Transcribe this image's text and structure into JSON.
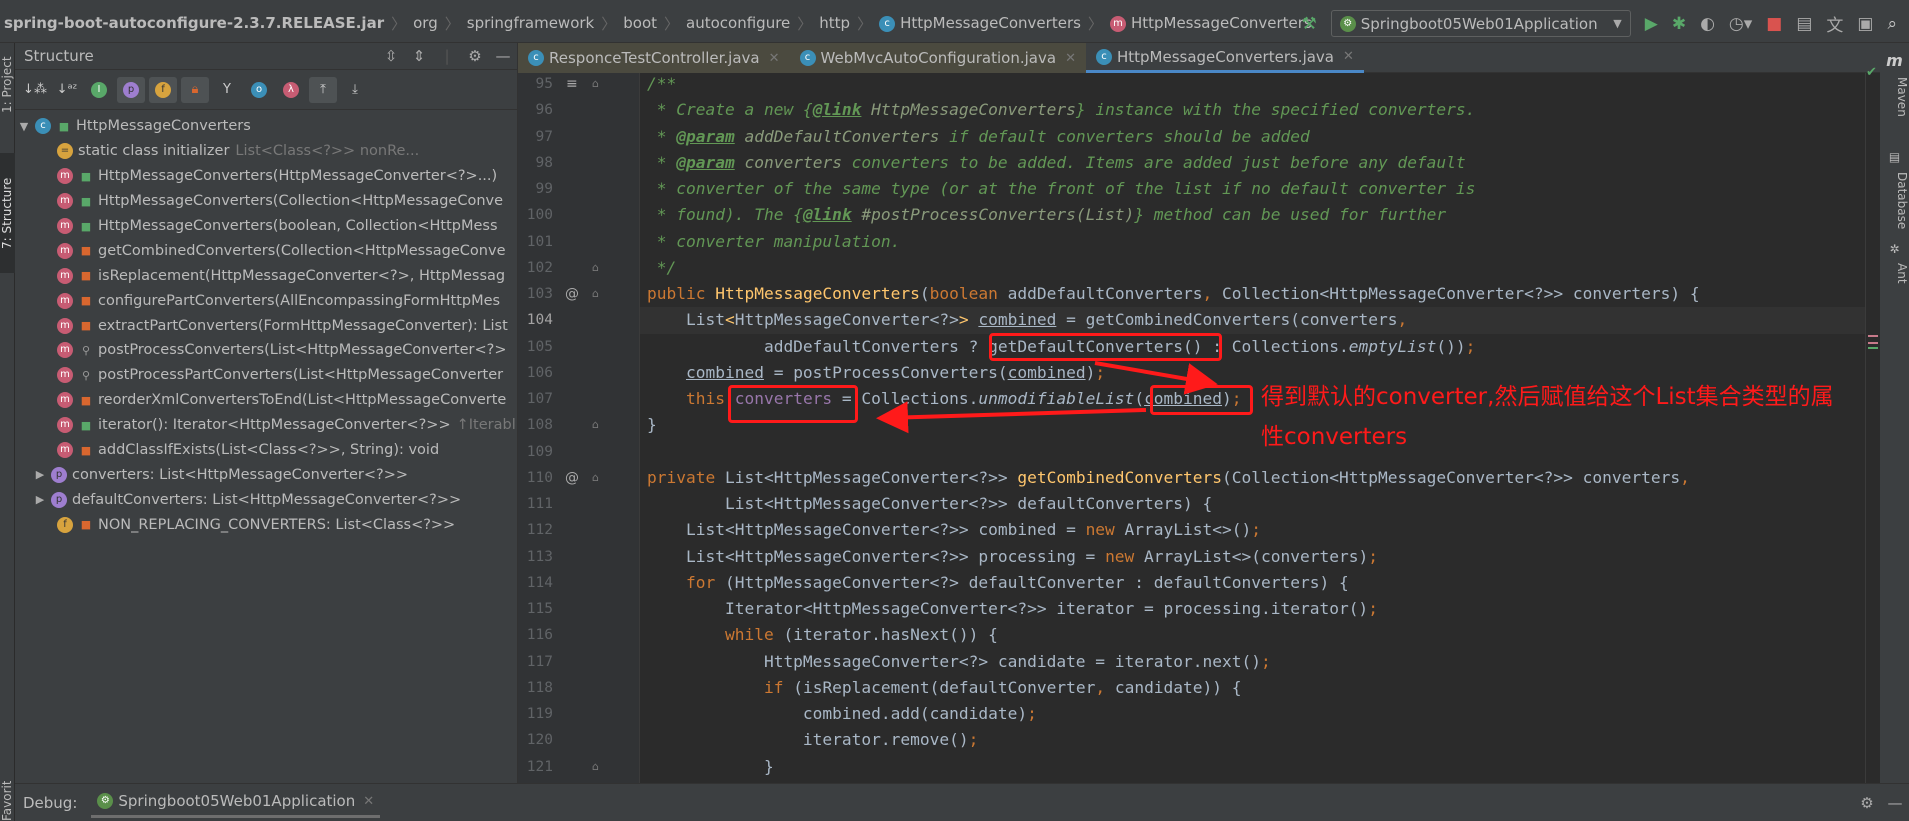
{
  "breadcrumb": [
    {
      "label": "spring-boot-autoconfigure-2.3.7.RELEASE.jar",
      "bold": true
    },
    {
      "label": "org"
    },
    {
      "label": "springframework"
    },
    {
      "label": "boot"
    },
    {
      "label": "autoconfigure"
    },
    {
      "label": "http"
    },
    {
      "label": "HttpMessageConverters",
      "icon": "c"
    },
    {
      "label": "HttpMessageConverters",
      "icon": "m"
    }
  ],
  "run_config": "Springboot05Web01Application",
  "left_strip": {
    "project": "1: Project",
    "structure": "7: Structure",
    "favorites": "Favorites"
  },
  "structure": {
    "title": "Structure",
    "tree": [
      {
        "level": 0,
        "expander": "down",
        "icon": "c",
        "access": "pub",
        "label": "HttpMessageConverters"
      },
      {
        "level": 1,
        "icon": "s",
        "access": "",
        "label": "static class initializer",
        "extra": "List<Class<?>> nonRe..."
      },
      {
        "level": 1,
        "icon": "m",
        "access": "pub",
        "label": "HttpMessageConverters(HttpMessageConverter<?>...)"
      },
      {
        "level": 1,
        "icon": "m",
        "access": "pub",
        "label": "HttpMessageConverters(Collection<HttpMessageConve"
      },
      {
        "level": 1,
        "icon": "m",
        "access": "pub",
        "label": "HttpMessageConverters(boolean, Collection<HttpMess"
      },
      {
        "level": 1,
        "icon": "m",
        "access": "pri",
        "label": "getCombinedConverters(Collection<HttpMessageConve"
      },
      {
        "level": 1,
        "icon": "m",
        "access": "pri",
        "label": "isReplacement(HttpMessageConverter<?>, HttpMessag"
      },
      {
        "level": 1,
        "icon": "m",
        "access": "pri",
        "label": "configurePartConverters(AllEncompassingFormHttpMes"
      },
      {
        "level": 1,
        "icon": "m",
        "access": "pri",
        "label": "extractPartConverters(FormHttpMessageConverter): List"
      },
      {
        "level": 1,
        "icon": "m",
        "access": "pkg",
        "label": "postProcessConverters(List<HttpMessageConverter<?>"
      },
      {
        "level": 1,
        "icon": "m",
        "access": "pkg",
        "label": "postProcessPartConverters(List<HttpMessageConverter"
      },
      {
        "level": 1,
        "icon": "m",
        "access": "pri",
        "label": "reorderXmlConvertersToEnd(List<HttpMessageConverte"
      },
      {
        "level": 1,
        "icon": "m",
        "access": "pub",
        "label": "iterator(): Iterator<HttpMessageConverter<?>>",
        "extra": "↑Iterabl"
      },
      {
        "level": 1,
        "icon": "m",
        "access": "pri",
        "label": "addClassIfExists(List<Class<?>>, String): void"
      },
      {
        "level": 1,
        "expander": "right",
        "icon": "p",
        "access": "",
        "label": "converters: List<HttpMessageConverter<?>>"
      },
      {
        "level": 1,
        "expander": "right",
        "icon": "p",
        "access": "",
        "label": "defaultConverters: List<HttpMessageConverter<?>>"
      },
      {
        "level": 1,
        "icon": "f",
        "access": "pri",
        "label": "NON_REPLACING_CONVERTERS: List<Class<?>>"
      }
    ]
  },
  "tabs": [
    {
      "label": "ResponceTestController.java",
      "active": false
    },
    {
      "label": "WebMvcAutoConfiguration.java",
      "active": false
    },
    {
      "label": "HttpMessageConverters.java",
      "active": true
    }
  ],
  "editor": {
    "current_line": 104,
    "lines": [
      {
        "n": 95,
        "mark": "fold",
        "t": [
          [
            "c",
            "/**"
          ]
        ]
      },
      {
        "n": 96,
        "t": [
          [
            "c",
            " * Create a new {"
          ],
          [
            "ct",
            "@link"
          ],
          [
            "cl",
            " HttpMessageConverters"
          ],
          [
            "c",
            "} instance with the specified converters."
          ]
        ]
      },
      {
        "n": 97,
        "t": [
          [
            "c",
            " * "
          ],
          [
            "ct",
            "@param"
          ],
          [
            "cl",
            " addDefaultConverters"
          ],
          [
            "c",
            " if default converters should be added"
          ]
        ]
      },
      {
        "n": 98,
        "t": [
          [
            "c",
            " * "
          ],
          [
            "ct",
            "@param"
          ],
          [
            "cl",
            " converters"
          ],
          [
            "c",
            " converters to be added. Items are added just before any default"
          ]
        ]
      },
      {
        "n": 99,
        "t": [
          [
            "c",
            " * converter of the same type (or at the front of the list if no default converter is"
          ]
        ]
      },
      {
        "n": 100,
        "t": [
          [
            "c",
            " * found). The {"
          ],
          [
            "ct",
            "@link"
          ],
          [
            "cl",
            " #postProcessConverters(List)"
          ],
          [
            "c",
            "} method can be used for further"
          ]
        ]
      },
      {
        "n": 101,
        "t": [
          [
            "c",
            " * converter manipulation."
          ]
        ]
      },
      {
        "n": 102,
        "mark": "foldend",
        "t": [
          [
            "c",
            " */"
          ]
        ]
      },
      {
        "n": 103,
        "mark": "at",
        "t": [
          [
            "k",
            "public "
          ],
          [
            "m",
            "HttpMessageConverters"
          ],
          [
            "p",
            "("
          ],
          [
            "k",
            "boolean "
          ],
          [
            "p",
            "addDefaultConverters"
          ],
          [
            "pn",
            ", "
          ],
          [
            "p",
            "Collection<HttpMessageConverter<?>> converters) {"
          ]
        ]
      },
      {
        "n": 104,
        "t": [
          [
            "p",
            "    List"
          ],
          [
            "m",
            "<"
          ],
          [
            "p",
            "HttpMessageConverter<?>"
          ],
          [
            "m",
            ">"
          ],
          [
            "p",
            " "
          ],
          [
            "u",
            "combined"
          ],
          [
            "p",
            " = getCombinedConverters(converters"
          ],
          [
            "pn",
            ","
          ]
        ]
      },
      {
        "n": 105,
        "t": [
          [
            "p",
            "            addDefaultConverters ? getDefaultConverters() : Collections."
          ],
          [
            "i",
            "emptyList"
          ],
          [
            "p",
            "())"
          ],
          [
            "pn",
            ";"
          ]
        ]
      },
      {
        "n": 106,
        "t": [
          [
            "p",
            "    "
          ],
          [
            "u",
            "combined"
          ],
          [
            "p",
            " = postProcessConverters("
          ],
          [
            "u",
            "combined"
          ],
          [
            "p",
            ")"
          ],
          [
            "pn",
            ";"
          ]
        ]
      },
      {
        "n": 107,
        "t": [
          [
            "p",
            "    "
          ],
          [
            "k",
            "this"
          ],
          [
            "p",
            "."
          ],
          [
            "f",
            "converters"
          ],
          [
            "p",
            " = Collections."
          ],
          [
            "i",
            "unmodifiableList"
          ],
          [
            "p",
            "("
          ],
          [
            "u",
            "combined"
          ],
          [
            "p",
            ")"
          ],
          [
            "pn",
            ";"
          ]
        ]
      },
      {
        "n": 108,
        "mark": "foldend",
        "t": [
          [
            "p",
            "}"
          ]
        ]
      },
      {
        "n": 109,
        "t": []
      },
      {
        "n": 110,
        "mark": "at",
        "t": [
          [
            "k",
            "private "
          ],
          [
            "p",
            "List<HttpMessageConverter<?>> "
          ],
          [
            "m",
            "getCombinedConverters"
          ],
          [
            "p",
            "(Collection<HttpMessageConverter<?>> converters"
          ],
          [
            "pn",
            ","
          ]
        ]
      },
      {
        "n": 111,
        "t": [
          [
            "p",
            "        List<HttpMessageConverter<?>> defaultConverters) {"
          ]
        ]
      },
      {
        "n": 112,
        "t": [
          [
            "p",
            "    List<HttpMessageConverter<?>> combined = "
          ],
          [
            "k",
            "new "
          ],
          [
            "p",
            "ArrayList<>()"
          ],
          [
            "pn",
            ";"
          ]
        ]
      },
      {
        "n": 113,
        "t": [
          [
            "p",
            "    List<HttpMessageConverter<?>> processing = "
          ],
          [
            "k",
            "new "
          ],
          [
            "p",
            "ArrayList<>(converters)"
          ],
          [
            "pn",
            ";"
          ]
        ]
      },
      {
        "n": 114,
        "t": [
          [
            "p",
            "    "
          ],
          [
            "k",
            "for "
          ],
          [
            "p",
            "(HttpMessageConverter<?> defaultConverter : defaultConverters) {"
          ]
        ]
      },
      {
        "n": 115,
        "t": [
          [
            "p",
            "        Iterator<HttpMessageConverter<?>> iterator = processing.iterator()"
          ],
          [
            "pn",
            ";"
          ]
        ]
      },
      {
        "n": 116,
        "t": [
          [
            "p",
            "        "
          ],
          [
            "k",
            "while "
          ],
          [
            "p",
            "(iterator.hasNext()) {"
          ]
        ]
      },
      {
        "n": 117,
        "t": [
          [
            "p",
            "            HttpMessageConverter<?> candidate = iterator.next()"
          ],
          [
            "pn",
            ";"
          ]
        ]
      },
      {
        "n": 118,
        "t": [
          [
            "p",
            "            "
          ],
          [
            "k",
            "if "
          ],
          [
            "p",
            "(isReplacement(defaultConverter"
          ],
          [
            "pn",
            ", "
          ],
          [
            "p",
            "candidate)) {"
          ]
        ]
      },
      {
        "n": 119,
        "t": [
          [
            "p",
            "                combined.add(candidate)"
          ],
          [
            "pn",
            ";"
          ]
        ]
      },
      {
        "n": 120,
        "t": [
          [
            "p",
            "                iterator.remove()"
          ],
          [
            "pn",
            ";"
          ]
        ]
      },
      {
        "n": 121,
        "mark": "foldend",
        "t": [
          [
            "p",
            "            }"
          ]
        ]
      }
    ]
  },
  "annotation": {
    "line1": "得到默认的converter,然后赋值给这个List集合类型的属",
    "line2": "性converters",
    "color": "#ff1a1a"
  },
  "right_strip": {
    "maven": "Maven",
    "database": "Database",
    "ant": "Ant"
  },
  "debug": {
    "label": "Debug:",
    "session": "Springboot05Web01Application"
  },
  "colors": {
    "keyword": "#cc7832",
    "comment": "#629755",
    "field": "#9876aa",
    "method": "#ffc66d",
    "text": "#a9b7c6",
    "accent": "#4a88c7"
  }
}
